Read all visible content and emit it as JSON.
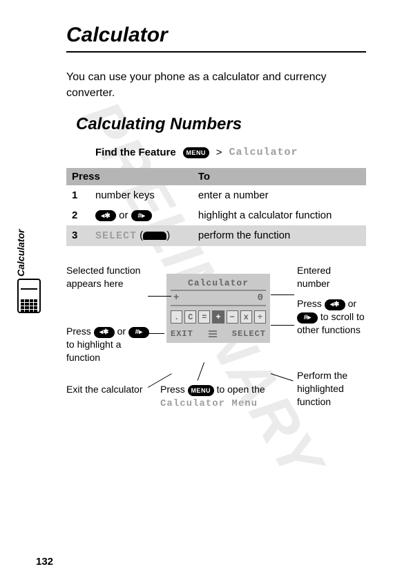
{
  "watermark": "PRELIMINARY",
  "title": "Calculator",
  "intro": "You can use your phone as a calculator and currency converter.",
  "subtitle": "Calculating Numbers",
  "feature": {
    "label": "Find the Feature",
    "menu_key": "MENU",
    "arrow": ">",
    "target": "Calculator"
  },
  "table": {
    "head_press": "Press",
    "head_to": "To",
    "rows": [
      {
        "n": "1",
        "press": "number keys",
        "to": "enter a number"
      },
      {
        "n": "2",
        "press_oval_left": "◂✱",
        "press_word": " or ",
        "press_oval_right": "#▸",
        "to": "highlight a calculator function"
      },
      {
        "n": "3",
        "press_select": "SELECT",
        "press_paren": " (",
        "press_paren2": ")",
        "to": "perform the function"
      }
    ]
  },
  "side_tab": "Calculator",
  "screen": {
    "title": "Calculator",
    "left_symbol": "+",
    "value": "0",
    "ops": [
      ".",
      "C",
      "=",
      "+",
      "−",
      "x",
      "÷"
    ],
    "selected_op_index": 3,
    "softkey_left": "EXIT",
    "softkey_right": "SELECT"
  },
  "annots": {
    "left1": "Selected function appears here",
    "left2_a": "Press ",
    "left2_key1": "◂✱",
    "left2_mid": " or ",
    "left2_key2": "#▸",
    "left2_b": " to highlight a function",
    "left3": "Exit the calculator",
    "bottom_a": "Press ",
    "bottom_key": "MENU",
    "bottom_b": " to open the ",
    "bottom_mono": "Calculator Menu",
    "right1": "Entered number",
    "right2_a": "Press ",
    "right2_key1": "◂✱",
    "right2_mid": " or ",
    "right2_key2": "#▸",
    "right2_b": " to scroll to other functions",
    "right3": "Perform the highlighted function"
  },
  "page_number": "132"
}
